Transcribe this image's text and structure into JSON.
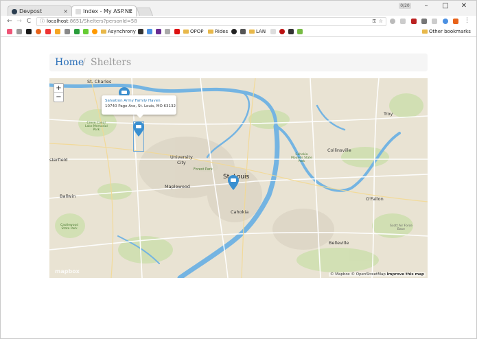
{
  "browser": {
    "tabs": [
      {
        "title": "Devpost",
        "close": "×"
      },
      {
        "title": "Index - My ASP.NE",
        "close": "×"
      }
    ],
    "profile_label": "0/20",
    "window_controls": {
      "minimize": "–",
      "maximize": "□",
      "close": "✕"
    },
    "nav": {
      "back": "←",
      "forward": "→",
      "reload": "C"
    },
    "address": {
      "host": "localhost",
      "rest": ":8651/Shelters?personId=58",
      "info": "ⓘ"
    },
    "bookmarks": {
      "items": [
        "Asynchrony",
        "OPOP",
        "Rides",
        "LAN"
      ],
      "other": "Other bookmarks"
    }
  },
  "breadcrumb": {
    "home": "Home",
    "separator": "/",
    "current": "Shelters"
  },
  "map": {
    "zoom_in": "+",
    "zoom_out": "−",
    "popup": {
      "name": "Salvation Army Family Haven",
      "address": "10740 Page Ave, St. Louis, MO 63132"
    },
    "labels": {
      "st_charles": "St. Charles",
      "university_city": "University\nCity",
      "st_louis": "St. Louis",
      "chesterfield": "sterfield",
      "maplewood": "Maplewood",
      "ballwin": "Ballwin",
      "cahokia": "Cahokia",
      "belleville": "Belleville",
      "ofallon": "O'Fallon",
      "collinsville": "Collinsville",
      "troy": "Troy",
      "forest_park": "Forest Park",
      "creve_coeur": "Creve Coeur\nLake Memorial\nPark",
      "cahokia_mounds": "Cahokia\nMounds State\nPark",
      "scott_afb": "Scott Air Force\nBase",
      "castlewood": "Castlewood\nState Park"
    },
    "attribution": {
      "mapbox": "© Mapbox",
      "osm": "© OpenStreetMap",
      "improve": "Improve this map"
    },
    "logo": "mapbox",
    "pin_color": "#3a8fd0"
  }
}
